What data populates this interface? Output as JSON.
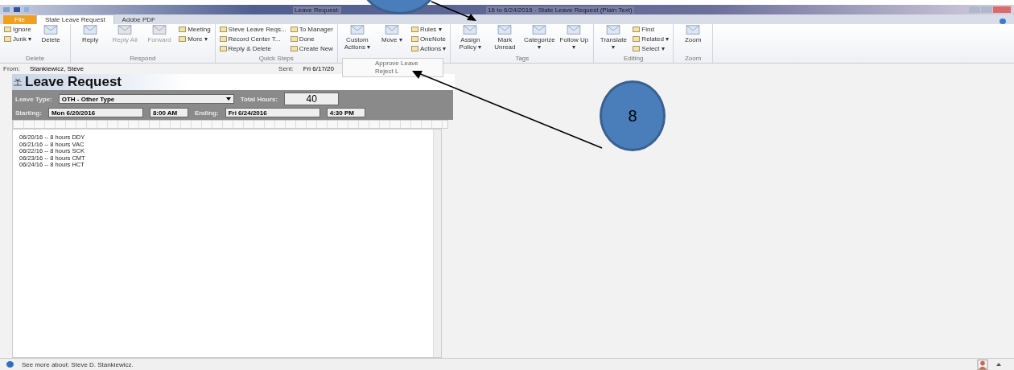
{
  "window": {
    "title_start": "Leave Request:",
    "title_end": "16 to 6/24/2016 - State Leave Request (Plain Text)"
  },
  "tabs": [
    {
      "label": "File",
      "selected": false,
      "kind": "file"
    },
    {
      "label": "State Leave Request",
      "selected": true,
      "kind": "tab"
    },
    {
      "label": "Adobe PDF",
      "selected": false,
      "kind": "tab"
    }
  ],
  "ribbon": {
    "groups": [
      {
        "label": "Delete",
        "items": [
          {
            "label": "Ignore",
            "kind": "small"
          },
          {
            "label": "Junk ▾",
            "kind": "small"
          },
          {
            "label": "Delete",
            "kind": "large"
          }
        ]
      },
      {
        "label": "Respond",
        "items": [
          {
            "label": "Reply",
            "kind": "large"
          },
          {
            "label": "Reply All",
            "kind": "large",
            "disabled": true
          },
          {
            "label": "Forward",
            "kind": "large",
            "disabled": true
          },
          {
            "label": "Meeting",
            "kind": "small"
          },
          {
            "label": "More ▾",
            "kind": "small"
          }
        ]
      },
      {
        "label": "Quick Steps",
        "items": [
          {
            "label": "Steve Leave Reqs...",
            "kind": "small"
          },
          {
            "label": "Record Center T...",
            "kind": "small"
          },
          {
            "label": "Reply & Delete",
            "kind": "small"
          },
          {
            "label": "To Manager",
            "kind": "small"
          },
          {
            "label": "Done",
            "kind": "small"
          },
          {
            "label": "Create New",
            "kind": "small"
          }
        ]
      },
      {
        "items": [
          {
            "label": "Custom Actions ▾",
            "kind": "large"
          },
          {
            "label": "Move ▾",
            "kind": "large"
          },
          {
            "label": "Rules ▾",
            "kind": "small"
          },
          {
            "label": "OneNote",
            "kind": "small"
          },
          {
            "label": "Actions ▾",
            "kind": "small"
          }
        ]
      },
      {
        "label": "Tags",
        "items": [
          {
            "label": "Assign Policy ▾",
            "kind": "large"
          },
          {
            "label": "Mark Unread",
            "kind": "large"
          },
          {
            "label": "Categorize ▾",
            "kind": "large"
          },
          {
            "label": "Follow Up ▾",
            "kind": "large"
          }
        ]
      },
      {
        "label": "Editing",
        "items": [
          {
            "label": "Translate ▾",
            "kind": "large"
          },
          {
            "label": "Find",
            "kind": "small"
          },
          {
            "label": "Related ▾",
            "kind": "small"
          },
          {
            "label": "Select ▾",
            "kind": "small"
          }
        ]
      },
      {
        "label": "Zoom",
        "items": [
          {
            "label": "Zoom",
            "kind": "large"
          }
        ]
      }
    ]
  },
  "menu": {
    "items": [
      "Approve Leave",
      "Reject L"
    ]
  },
  "header": {
    "from_label": "From:",
    "from": "Stankiewicz, Steve",
    "sent_label": "Sent:",
    "sent": "Fri 6/17/20"
  },
  "form": {
    "title": "Leave Request",
    "leave_type_label": "Leave Type:",
    "leave_type": "OTH - Other Type",
    "total_hours_label": "Total Hours:",
    "total_hours": "40",
    "starting_label": "Starting:",
    "start_date": "Mon 6/20/2016",
    "start_time": "8:00 AM",
    "ending_label": "Ending:",
    "end_date": "Fri 6/24/2016",
    "end_time": "4:30 PM"
  },
  "body": {
    "lines": [
      "06/20/16 -- 8 hours DDY",
      "06/21/16 -- 8 hours VAC",
      "06/22/16 -- 8 hours SCK",
      "06/23/16 -- 8 hours CMT",
      "06/24/16 -- 8 hours HCT"
    ]
  },
  "status_bar": {
    "text": "See more about: Steve D. Stankiewicz."
  },
  "callouts": [
    {
      "label": "8"
    }
  ]
}
